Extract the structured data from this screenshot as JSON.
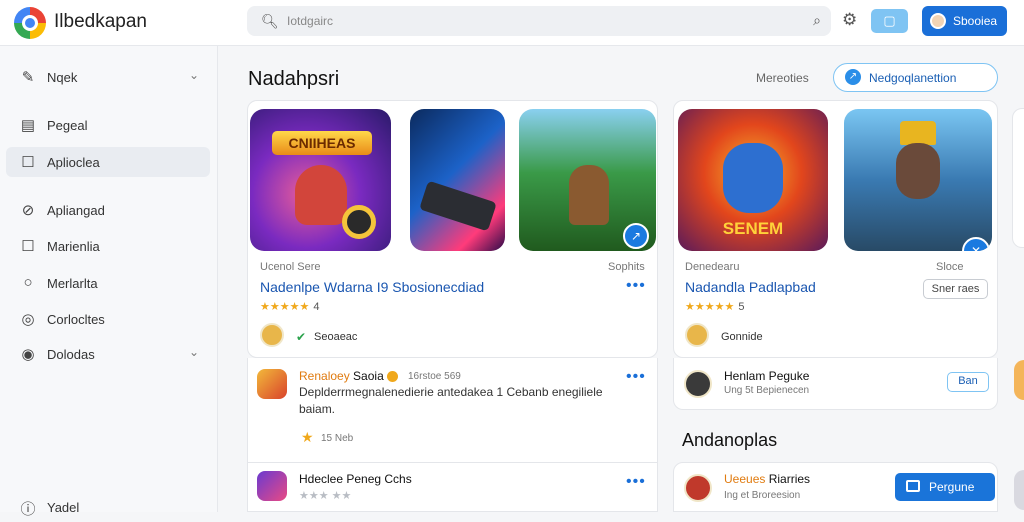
{
  "app": {
    "name": "Ilbedkapan"
  },
  "search": {
    "placeholder": "Iotdgairc"
  },
  "topbar": {
    "square_icon": "▢",
    "user_label": "Sbooiea"
  },
  "sidebar": {
    "items": [
      {
        "label": "Nqek",
        "icon": "pencil-icon",
        "glyph": "✎",
        "chevron": true
      },
      {
        "label": "Pegeal",
        "icon": "table-icon",
        "glyph": "▤"
      },
      {
        "label": "Aplioclea",
        "icon": "square-icon",
        "glyph": "☐",
        "active": true
      },
      {
        "label": "Apliangad",
        "icon": "tag-icon",
        "glyph": "⊘"
      },
      {
        "label": "Marienlia",
        "icon": "square-icon",
        "glyph": "☐"
      },
      {
        "label": "Merlarlta",
        "icon": "circle-icon",
        "glyph": "○"
      },
      {
        "label": "Corlocltes",
        "icon": "target-icon",
        "glyph": "◎"
      },
      {
        "label": "Dolodas",
        "icon": "play-icon",
        "glyph": "◉",
        "chevron": true
      },
      {
        "label": "Yadel",
        "icon": "info-icon",
        "glyph": "ⓘ"
      }
    ]
  },
  "main": {
    "title": "Nadahpsri",
    "more_label": "Mereoties",
    "pill_label": "Nedgoqlanettion",
    "pill_icon": "↗"
  },
  "card_a": {
    "tile1_text": "CNIIHEAS",
    "caption_left": "Ucenol Sere",
    "caption_right": "Sophits",
    "title": "Nadenlpe Wdarna I9 Sbosionecdiad",
    "stars": "★★★★★",
    "rating": "4",
    "developer": "Seoaeac",
    "badge_icon": "↗"
  },
  "card_b": {
    "tile4_text": "SENEM",
    "caption_left": "Denedearu",
    "caption_right": "Sloce",
    "title": "Nadandla Padlapbad",
    "stars": "★★★★★",
    "rating": "5",
    "developer": "Gonnide",
    "out_label": "Sner raes",
    "badge_icon": "✕"
  },
  "feed": {
    "item1": {
      "title_highlight": "Renaloey",
      "title_rest": "Saoia",
      "meta": "16rstoe 569",
      "body": "Deplderrmegnalenedierie antedakea 1 Cebanb enegiliele baiam.",
      "rating_star": "★",
      "rating_text": "15 Neb"
    },
    "item2": {
      "title": "Hdeclee Peneg Cchs",
      "stars": "★★★ ★★"
    }
  },
  "list_b": {
    "name": "Henlam Peguke",
    "meta": "Ung 5t Bepienecen",
    "button": "Ban"
  },
  "section2": {
    "title": "Andanoplas"
  },
  "list_c": {
    "name_highlight": "Ueeues",
    "name_rest": "Riarries",
    "meta": "Ing et Broreesion",
    "button": "Pergune"
  }
}
